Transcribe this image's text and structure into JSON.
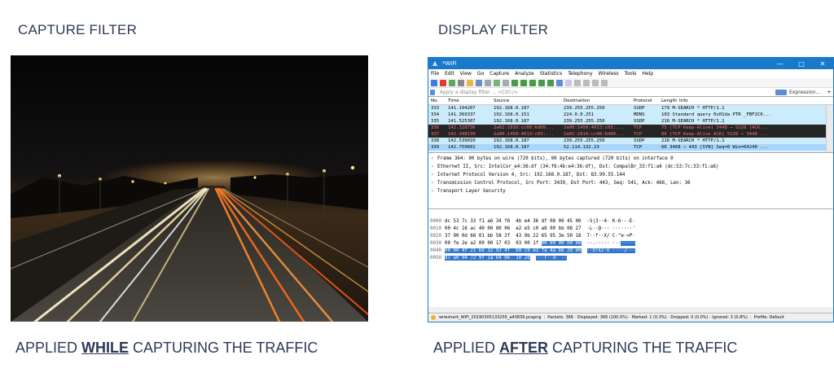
{
  "left": {
    "heading": "CAPTURE FILTER",
    "caption_prefix": "APPLIED ",
    "caption_emphasis": "WHILE",
    "caption_suffix": " CAPTURING THE TRAFFIC"
  },
  "right": {
    "heading": "DISPLAY FILTER",
    "caption_prefix": "APPLIED ",
    "caption_emphasis": "AFTER",
    "caption_suffix": " CAPTURING THE TRAFFIC"
  },
  "wireshark": {
    "title": "*WiFi",
    "window_buttons": [
      "—",
      "□",
      "✕"
    ],
    "menu": [
      "File",
      "Edit",
      "View",
      "Go",
      "Capture",
      "Analyze",
      "Statistics",
      "Telephony",
      "Wireless",
      "Tools",
      "Help"
    ],
    "filter_placeholder": "Apply a display filter ... <Ctrl-/>",
    "filter_expression": "Expression...",
    "filter_plus": "+",
    "columns": [
      "No.",
      "Time",
      "Source",
      "Destination",
      "Protocol",
      "Length",
      "Info"
    ],
    "packets": [
      {
        "no": "333",
        "time": "141.194207",
        "src": "192.168.0.187",
        "dst": "239.255.255.250",
        "proto": "SSDP",
        "info": "179 M-SEARCH * HTTP/1.1",
        "style": "ssdp"
      },
      {
        "no": "334",
        "time": "141.369337",
        "src": "192.168.0.151",
        "dst": "224.0.0.251",
        "proto": "MDNS",
        "info": "103 Standard query 0x01da PTR _FBF2C0...",
        "style": "mdns"
      },
      {
        "no": "335",
        "time": "141.525307",
        "src": "192.168.0.187",
        "dst": "239.255.255.250",
        "proto": "SSDP",
        "info": "216 M-SEARCH * HTTP/1.1",
        "style": "ssdp"
      },
      {
        "no": "336",
        "time": "142.328736",
        "src": "2a02:1810:cc08:6d00...",
        "dst": "2a00:1450:4013:c03:...",
        "proto": "TCP",
        "info": "75 [TCP Keep-Alive] 3448 → 5228 [ACK...",
        "style": "dark"
      },
      {
        "no": "337",
        "time": "142.348139",
        "src": "2a00:1450:4013:c03:...",
        "dst": "2a02:1810:cc08:6d00...",
        "proto": "TCP",
        "info": "86 [TCP Keep-Alive ACK] 5228 → 3448 ...",
        "style": "dark"
      },
      {
        "no": "338",
        "time": "142.539010",
        "src": "192.168.0.187",
        "dst": "239.255.255.250",
        "proto": "SSDP",
        "info": "216 M-SEARCH * HTTP/1.1",
        "style": "ssdp"
      },
      {
        "no": "339",
        "time": "142.759601",
        "src": "192.168.0.187",
        "dst": "52.114.132.23",
        "proto": "TCP",
        "info": "66 3468 → 443 [SYN] Seq=0 Win=64240 ...",
        "style": "sel"
      }
    ],
    "details": [
      "Frame 364: 90 bytes on wire (720 bits), 90 bytes captured (720 bits) on interface 0",
      "Ethernet II, Src: IntelCor_e4:36:df (34:f6:4b:e4:36:df), Dst: CompalBr_33:f1:a6 (dc:53:7c:33:f1:a6)",
      "Internet Protocol Version 4, Src: 192.168.0.187, Dst: 83.99.55.144",
      "Transmission Control Protocol, Src Port: 3430, Dst Port: 443, Seq: 541, Ack: 466, Len: 36",
      "Transport Layer Security"
    ],
    "bytes": [
      {
        "off": "0000",
        "hex": "dc 53 7c 33 f1 a6 34 f6  4b e4 36 df 08 00 45 00",
        "hl_hex": "",
        "hex_tail": "",
        "ascii": "  ·S|3··4· K·6···E·",
        "hl_ascii": ""
      },
      {
        "off": "0010",
        "hex": "00 4c 16 ac 40 00 80 06  e2 e5 c0 a8 00 bb 08 27",
        "hl_hex": "",
        "hex_tail": "",
        "ascii": "  ·L··@··· ·······'",
        "hl_ascii": ""
      },
      {
        "off": "0020",
        "hex": "37 90 0d 66 01 bb 58 2f  43 9b 22 65 95 3e 50 18",
        "hl_hex": "",
        "hex_tail": "",
        "ascii": "  7··f··X/ C·\"e·>P·",
        "hl_ascii": ""
      },
      {
        "off": "0030",
        "hex": "00 fe 2e a2 00 00 17 03  03 00 1f ",
        "hl_hex": "00 00 00 00 00",
        "hex_tail": "",
        "ascii": "  ··.····· ···",
        "hl_ascii": "·····"
      },
      {
        "off": "0040",
        "hex": "",
        "hl_hex": "00 00 4f 21 6b 32 93 4f  b9 c9 e3 fa 4a bb 2d e0",
        "hex_tail": "",
        "ascii": "  ",
        "hl_ascii": "··O!k2·O ····J·-·"
      },
      {
        "off": "0050",
        "hex": "",
        "hl_hex": "d7 a0 94 72 9f 1a 64 06  10 2d",
        "hex_tail": "",
        "ascii": "  ",
        "hl_ascii": "···r··d· ·-"
      }
    ],
    "status": {
      "file": "wireshark_WiFi_20190305133255_a40836.pcapng",
      "packets": "Packets: 366 · Displayed: 366 (100.0%) · Marked: 1 (0.3%) · Dropped: 0 (0.0%) · Ignored: 3 (0.8%)",
      "profile": "Profile: Default"
    }
  }
}
